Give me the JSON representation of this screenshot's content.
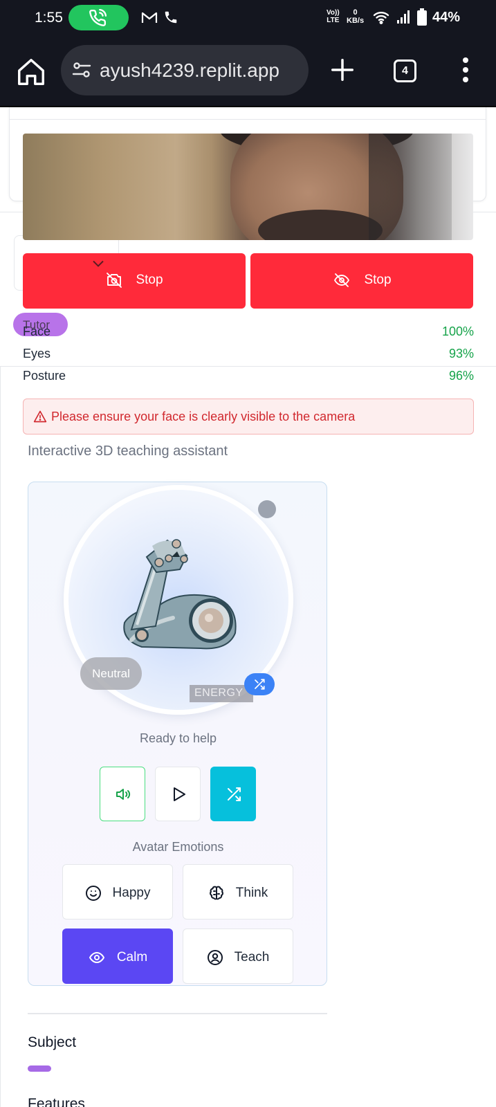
{
  "status_bar": {
    "time": "1:55",
    "network_top": "Vo))",
    "network_bottom": "LTE",
    "speed_value": "0",
    "speed_unit": "KB/s",
    "battery": "44%"
  },
  "browser": {
    "url": "ayush4239.replit.app",
    "tab_count": "4"
  },
  "camera": {
    "stop_camera_label": "Stop",
    "stop_tracking_label": "Stop",
    "tutor_badge": "Tutor"
  },
  "metrics": [
    {
      "label": "Face",
      "value": "100%"
    },
    {
      "label": "Eyes",
      "value": "93%"
    },
    {
      "label": "Posture",
      "value": "96%"
    }
  ],
  "alert": {
    "message": "Please ensure your face is clearly visible to the camera"
  },
  "assistant": {
    "subtitle": "Interactive 3D teaching assistant",
    "mood_label": "Neutral",
    "energy_label": "ENERGY",
    "status_text": "Ready to help",
    "emotions_title": "Avatar Emotions",
    "emotions": [
      {
        "label": "Happy",
        "icon": "smile-icon"
      },
      {
        "label": "Think",
        "icon": "brain-icon"
      },
      {
        "label": "Calm",
        "icon": "eye-icon",
        "active": true
      },
      {
        "label": "Teach",
        "icon": "user-circle-icon"
      }
    ]
  },
  "sections": {
    "subject": "Subject",
    "features": "Features"
  },
  "colors": {
    "stop_red": "#ff2a3a",
    "accent_purple": "#5b47f3",
    "cyan": "#06c0dc",
    "success_green": "#16a34a",
    "alert_red": "#d1282e"
  }
}
